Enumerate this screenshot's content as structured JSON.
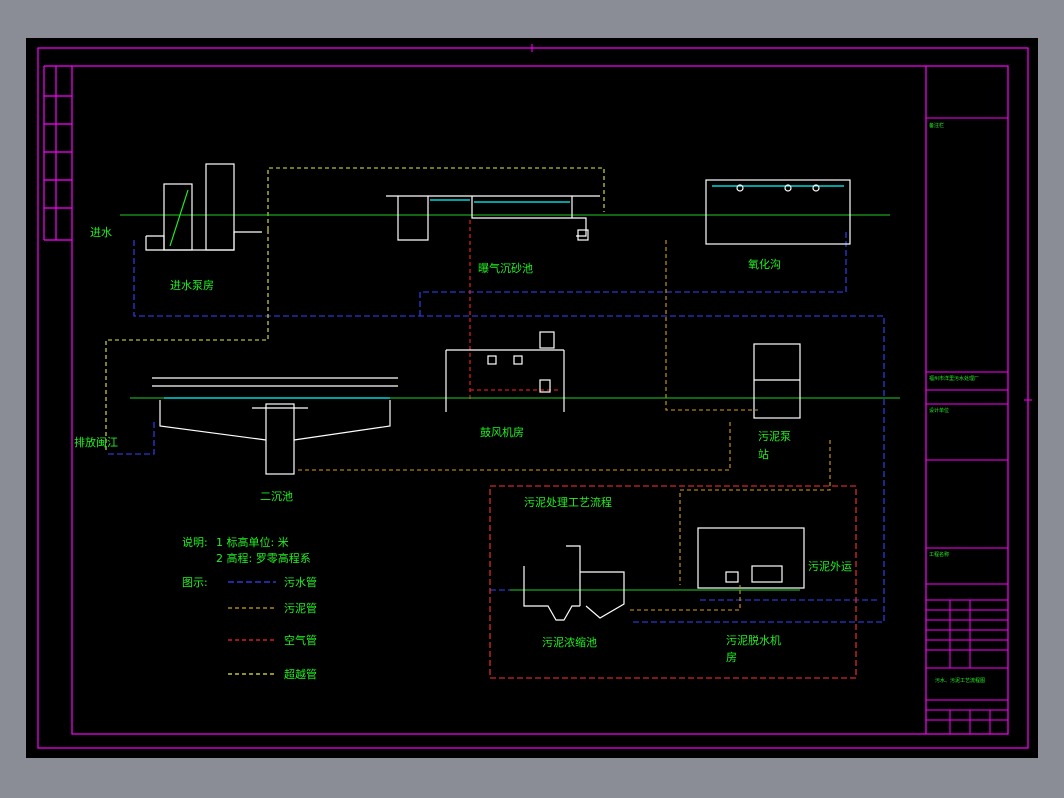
{
  "labels": {
    "inlet_water": "进水",
    "inlet_pump_house": "进水泵房",
    "aerated_grit_chamber": "曝气沉砂池",
    "oxidation_ditch": "氧化沟",
    "secondary_clarifier": "二沉池",
    "blower_house": "鼓风机房",
    "discharge_river": "排放闽江",
    "sludge_pump_station_1": "污泥泵",
    "sludge_pump_station_2": "站",
    "sludge_process_title": "污泥处理工艺流程",
    "sludge_thickener": "污泥浓缩池",
    "sludge_dewatering_1": "污泥脱水机",
    "sludge_dewatering_2": "房",
    "sludge_transport": "污泥外运"
  },
  "notes": {
    "title": "说明:",
    "note1": "1 标高单位: 米",
    "note2": "2 高程: 罗零高程系"
  },
  "legend": {
    "title": "图示:",
    "items": [
      {
        "label": "污水管",
        "color": "#3344ff",
        "dash": "6,3"
      },
      {
        "label": "污泥管",
        "color": "#d4a017",
        "dash": "4,3"
      },
      {
        "label": "空气管",
        "color": "#ff2222",
        "dash": "4,3"
      },
      {
        "label": "超越管",
        "color": "#e8e84a",
        "dash": "4,3"
      }
    ]
  },
  "colors": {
    "background": "#000000",
    "frame": "#ff00ff",
    "structure": "#ffffff",
    "water": "#00ffff",
    "text": "#22ee22",
    "sewage": "#3344ff",
    "sludge": "#d4a017",
    "air": "#ff2222",
    "bypass": "#e8e84a",
    "highlight": "#ff3333"
  },
  "title_block": {
    "rows": [
      "备注栏",
      "福州市洋里污水处理厂",
      "设计单位",
      "工程名称",
      "污水、污泥工艺流程图"
    ]
  }
}
